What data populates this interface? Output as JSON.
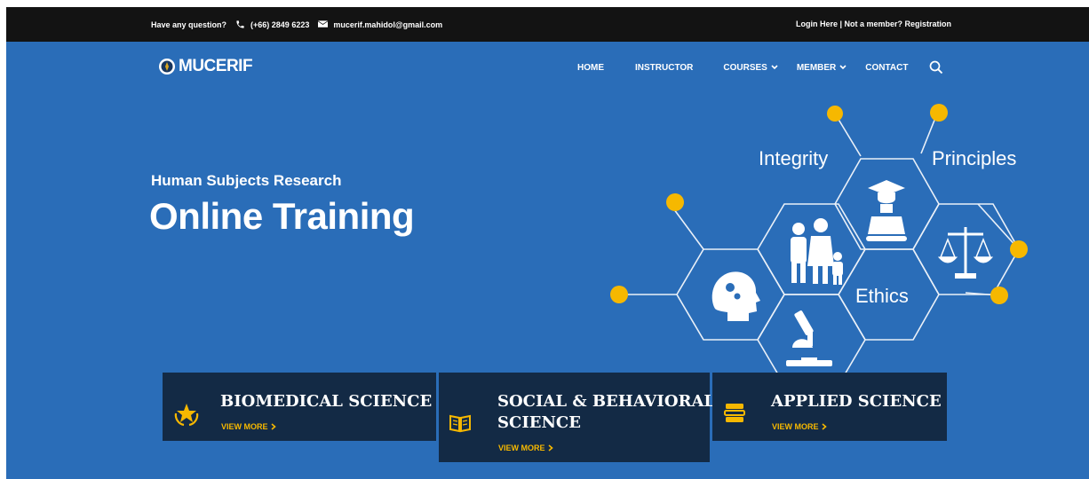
{
  "topbar": {
    "question": "Have any question?",
    "phone": "(+66) 2849 6223",
    "email": "mucerif.mahidol@gmail.com",
    "account_links": "Login Here | Not a member? Registration",
    "icons": [
      "phone-icon",
      "mail-icon"
    ]
  },
  "logo": {
    "text": "MUCERIF"
  },
  "nav": {
    "items": [
      {
        "label": "HOME"
      },
      {
        "label": "INSTRUCTOR"
      },
      {
        "label": "COURSES",
        "dropdown": true
      },
      {
        "label": "MEMBER",
        "dropdown": true
      },
      {
        "label": "CONTACT"
      }
    ],
    "search_icon": "search-icon"
  },
  "hero": {
    "subtitle": "Human Subjects Research",
    "title": "Online Training",
    "graphic_labels": {
      "integrity": "Integrity",
      "principles": "Principles",
      "ethics": "Ethics"
    }
  },
  "cards": [
    {
      "title": "BIOMEDICAL SCIENCE",
      "link": "VIEW MORE",
      "icon": "star-laurel-icon"
    },
    {
      "title_line1": "SOCIAL & BEHAVIORAL",
      "title_line2": "SCIENCE",
      "link": "VIEW MORE",
      "icon": "open-book-icon"
    },
    {
      "title": "APPLIED SCIENCE",
      "link": "VIEW MORE",
      "icon": "book-stack-icon"
    }
  ],
  "colors": {
    "hero_bg": "#2a6db8",
    "topbar_bg": "#131313",
    "card_bg": "#132a45",
    "accent": "#f6b800"
  }
}
